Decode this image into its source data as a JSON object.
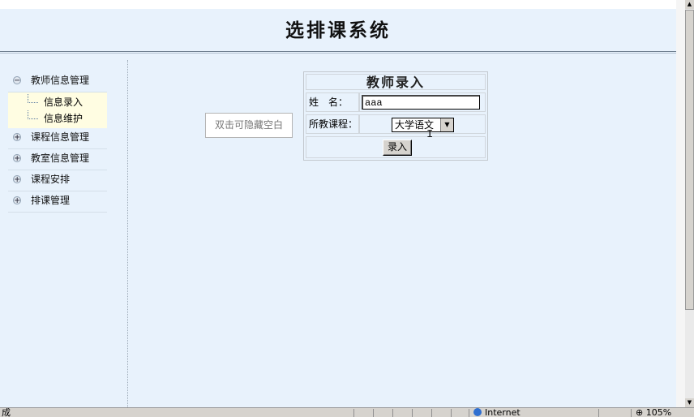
{
  "app": {
    "title": "选排课系统"
  },
  "sidebar": {
    "groups": [
      {
        "label": "教师信息管理",
        "toggle": "−",
        "expanded": true,
        "items": [
          {
            "label": "信息录入"
          },
          {
            "label": "信息维护"
          }
        ]
      },
      {
        "label": "课程信息管理",
        "toggle": "+"
      },
      {
        "label": "教室信息管理",
        "toggle": "+"
      },
      {
        "label": "课程安排",
        "toggle": "+"
      },
      {
        "label": "排课管理",
        "toggle": "+"
      }
    ]
  },
  "hide_toggle": {
    "label": "双击可隐藏空白"
  },
  "form": {
    "title": "教师录入",
    "name_label": "姓　名：",
    "name_value": "aaa",
    "course_label": "所教课程：",
    "course_value": "大学语文",
    "submit_label": "录入"
  },
  "statusbar": {
    "status": "成",
    "zone": "Internet",
    "zoom": "105%"
  }
}
